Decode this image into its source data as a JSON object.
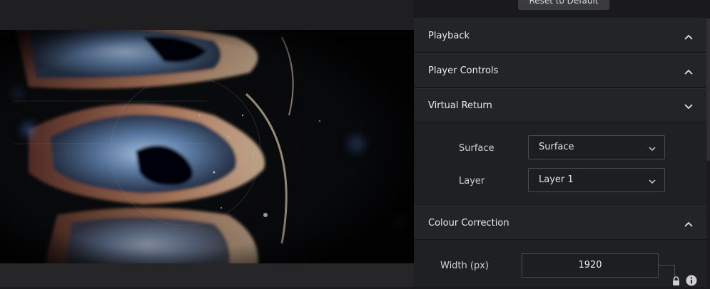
{
  "toolbar": {
    "reset_label": "Reset to Default"
  },
  "sections": {
    "playback": {
      "title": "Playback",
      "state": "collapsed-up"
    },
    "player_controls": {
      "title": "Player Controls",
      "state": "collapsed-up"
    },
    "virtual_return": {
      "title": "Virtual Return",
      "state": "expanded",
      "surface_label": "Surface",
      "surface_value": "Surface",
      "layer_label": "Layer",
      "layer_value": "Layer 1"
    },
    "colour_correction": {
      "title": "Colour Correction",
      "state": "collapsed-up",
      "width_label": "Width (px)",
      "width_value": "1920"
    }
  },
  "icons": {
    "lock": "lock-icon",
    "info": "info-icon",
    "chevron_up": "chevron-up-icon",
    "chevron_down": "chevron-down-icon"
  },
  "colors": {
    "panel_bg": "#1c1c1e",
    "header_bg": "#232427",
    "preview_bg": "#0c0d10"
  }
}
